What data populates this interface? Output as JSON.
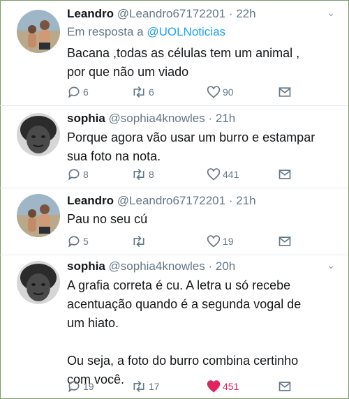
{
  "tweets": [
    {
      "name": "Leandro",
      "handle": "@Leandro67172201",
      "time": "· 22h",
      "reply_prefix": "Em resposta a",
      "reply_mention": "@UOLNoticias",
      "lines": [
        "Bacana ,todas as células tem um animal ,",
        "por que não um viado"
      ],
      "replies": "6",
      "retweets": "6",
      "likes": "90",
      "liked": false
    },
    {
      "name": "sophia",
      "handle": "@sophia4knowles",
      "time": "· 21h",
      "lines": [
        "Porque agora vão usar um burro e estampar",
        "sua foto na nota."
      ],
      "replies": "8",
      "retweets": "8",
      "likes": "441",
      "liked": false
    },
    {
      "name": "Leandro",
      "handle": "@Leandro67172201",
      "time": "· 21h",
      "lines": [
        "Pau no seu cú"
      ],
      "replies": "5",
      "retweets": "",
      "likes": "19",
      "liked": false
    },
    {
      "name": "sophia",
      "handle": "@sophia4knowles",
      "time": "· 20h",
      "lines": [
        "A grafia correta é cu. A letra u só recebe",
        "acentuação quando é a segunda vogal de",
        "um hiato.",
        "",
        "Ou seja, a foto do burro combina certinho",
        "com você."
      ],
      "replies": "19",
      "retweets": "17",
      "likes": "451",
      "liked": true
    }
  ],
  "icons": {
    "reply": "reply-icon",
    "retweet": "retweet-icon",
    "like": "heart-icon",
    "share": "dm-icon",
    "menu": "chevron-down-icon"
  },
  "colors": {
    "text": "#14171a",
    "secondary": "#657786",
    "link": "#1da1f2",
    "like_active": "#e0245e",
    "divider": "#e1e8ed"
  }
}
